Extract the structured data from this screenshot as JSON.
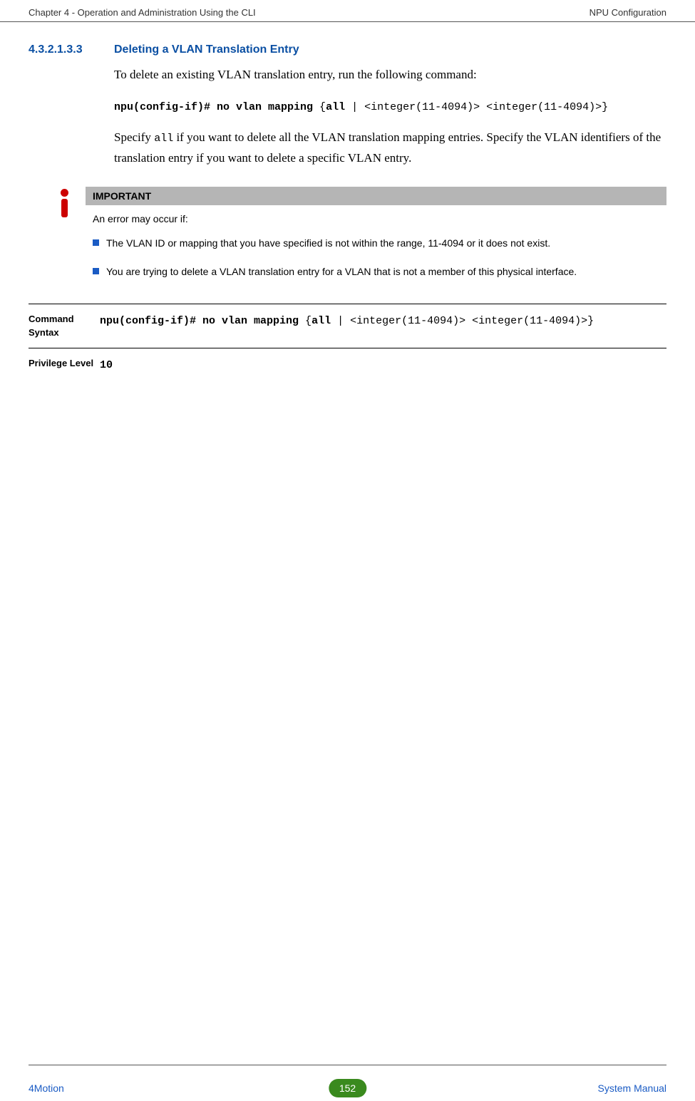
{
  "header": {
    "left": "Chapter 4 - Operation and Administration Using the CLI",
    "right": "NPU Configuration"
  },
  "section": {
    "number": "4.3.2.1.3.3",
    "title": "Deleting a VLAN Translation Entry"
  },
  "body": {
    "intro": "To delete an existing VLAN translation entry, run the following command:",
    "cmd_bold1": "npu(config-if)# no vlan mapping ",
    "cmd_plain1": "{",
    "cmd_bold2": "all",
    "cmd_plain2": " | <integer(11-4094)> <integer(11-4094)>}",
    "specify_pre": "Specify ",
    "specify_code": "all",
    "specify_post": " if you want to delete all the VLAN translation mapping entries. Specify the VLAN identifiers of the translation entry if you want to delete a specific VLAN entry."
  },
  "important": {
    "label": "IMPORTANT",
    "intro": "An error may occur if:",
    "bullets": [
      "The VLAN ID or mapping that you have specified is not within the range, 11-4094 or it does not exist.",
      "You are trying to delete a VLAN translation entry for a VLAN that is not a member of this physical interface."
    ]
  },
  "table": {
    "syntax_label": "Command Syntax",
    "syntax_bold1": "npu(config-if)# no vlan mapping ",
    "syntax_plain1": "{",
    "syntax_bold2": "all",
    "syntax_plain2": " | <integer(11-4094)> <integer(11-4094)>}",
    "priv_label": "Privilege Level",
    "priv_value": "10"
  },
  "footer": {
    "left": "4Motion",
    "page": "152",
    "right": "System Manual"
  }
}
